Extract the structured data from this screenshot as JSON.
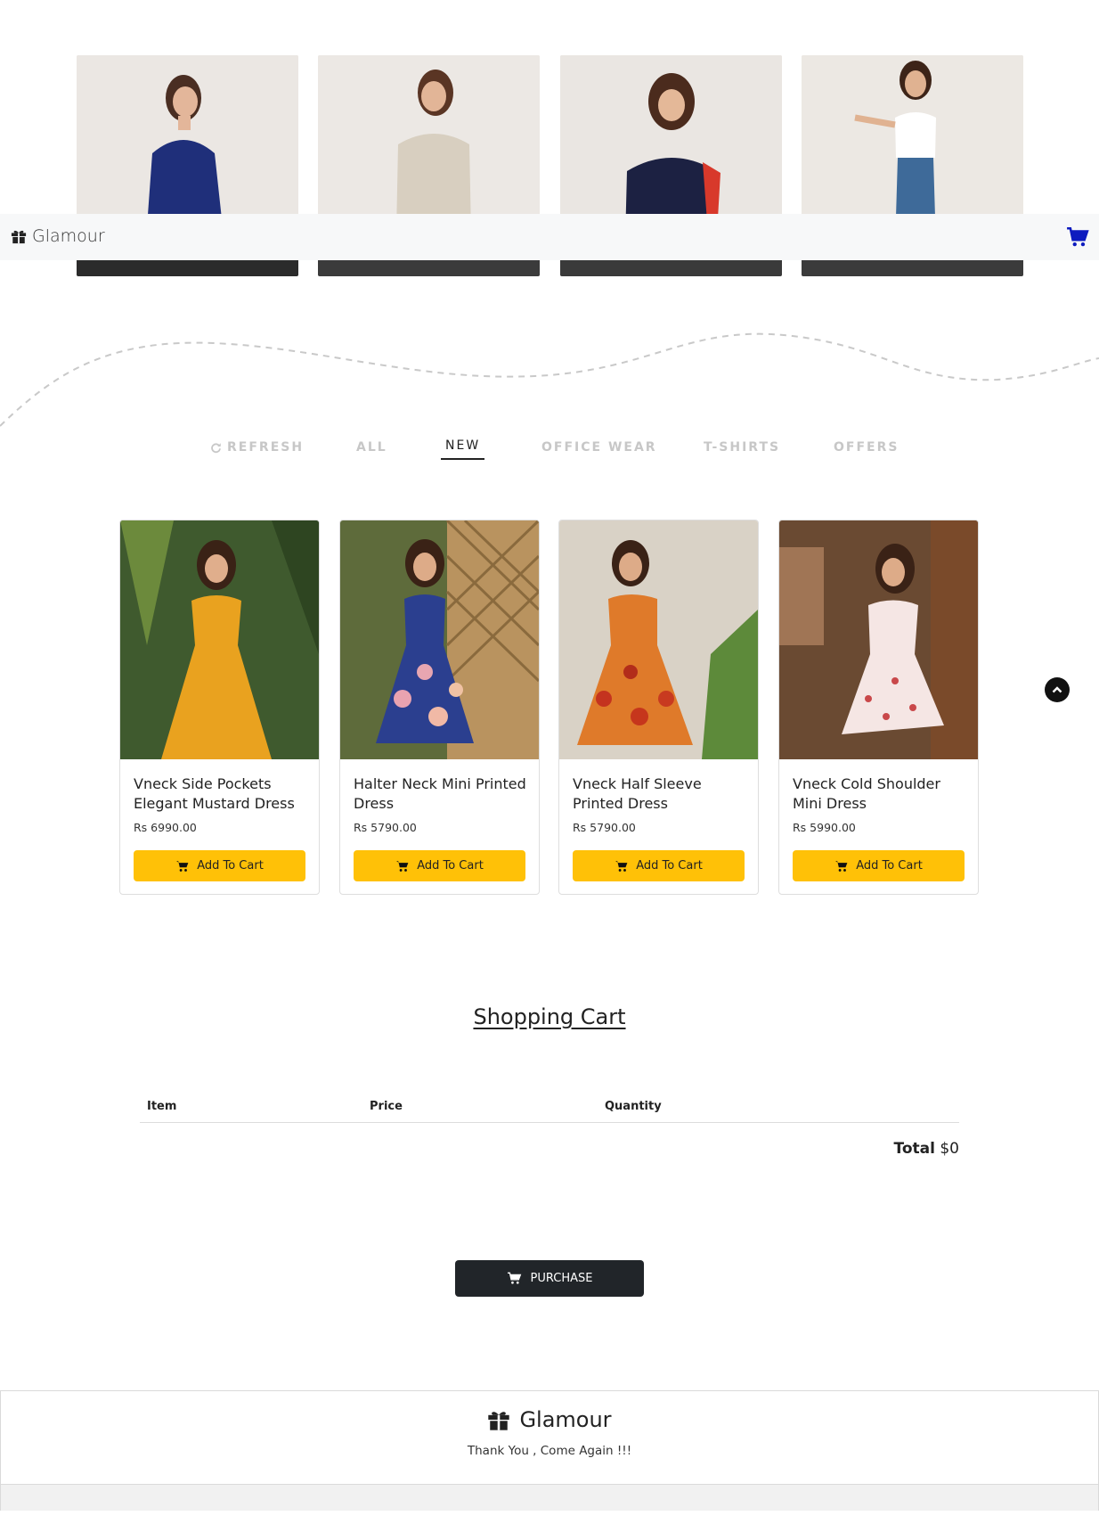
{
  "brand": {
    "name": "Glamour"
  },
  "filters": [
    "REFRESH",
    "ALL",
    "NEW",
    "OFFICE WEAR",
    "T-SHIRTS",
    "OFFERS"
  ],
  "active_filter": "NEW",
  "products": [
    {
      "name": "Vneck Side Pockets Elegant Mustard Dress",
      "price": "Rs 6990.00",
      "button": "Add To Cart"
    },
    {
      "name": "Halter Neck Mini Printed Dress",
      "price": "Rs 5790.00",
      "button": "Add To Cart"
    },
    {
      "name": "Vneck Half Sleeve Printed Dress",
      "price": "Rs 5790.00",
      "button": "Add To Cart"
    },
    {
      "name": "Vneck Cold Shoulder Mini Dress",
      "price": "Rs 5990.00",
      "button": "Add To Cart"
    }
  ],
  "cart": {
    "title": "Shopping Cart",
    "headers": {
      "item": "Item",
      "price": "Price",
      "quantity": "Quantity"
    },
    "total_label": "Total",
    "total_value": "$0",
    "purchase_label": "PURCHASE"
  },
  "footer": {
    "brand": "Glamour",
    "message": "Thank You , Come Again !!!"
  },
  "icons": [
    "gift-icon",
    "cart-icon",
    "refresh-icon",
    "chevron-up-icon"
  ],
  "colors": {
    "accent": "#ffc107",
    "dark": "#212529",
    "cart_icon": "#0d1bbf",
    "navbar": "#f7f8f9"
  }
}
